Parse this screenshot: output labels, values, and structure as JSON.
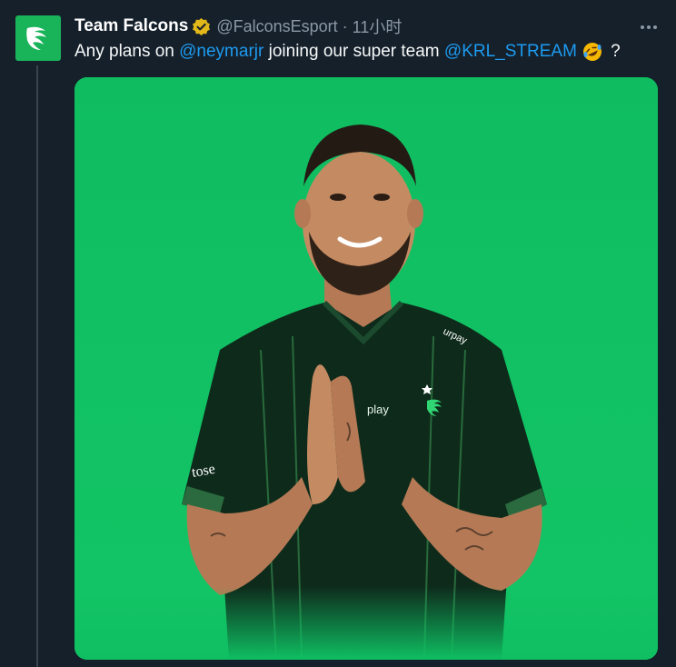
{
  "tweet": {
    "author": {
      "display_name": "Team Falcons",
      "handle": "@FalconsEsport",
      "verified_badge": "gold-verified-badge-icon",
      "avatar_icon": "falcon-logo-icon"
    },
    "separator": "·",
    "time": "11小时",
    "more_icon": "more-options-icon",
    "text": {
      "part1": "Any plans on ",
      "mention1": "@neymarjr",
      "part2": " joining our super team ",
      "mention2": "@KRL_STREAM",
      "emoji": "rolling-on-floor-laughing-emoji",
      "part3": " ?"
    },
    "media": {
      "description_icon": "tweet-photo",
      "background_color": "#0fbf62",
      "jersey_text": {
        "sponsor_top": "urpay",
        "sponsor_chest": "play",
        "sleeve": "tose"
      }
    }
  },
  "colors": {
    "background": "#15202b",
    "link": "#1d9bf0",
    "secondary_text": "#8b98a5",
    "thread_line": "#38444d",
    "brand_green": "#19b35a"
  }
}
